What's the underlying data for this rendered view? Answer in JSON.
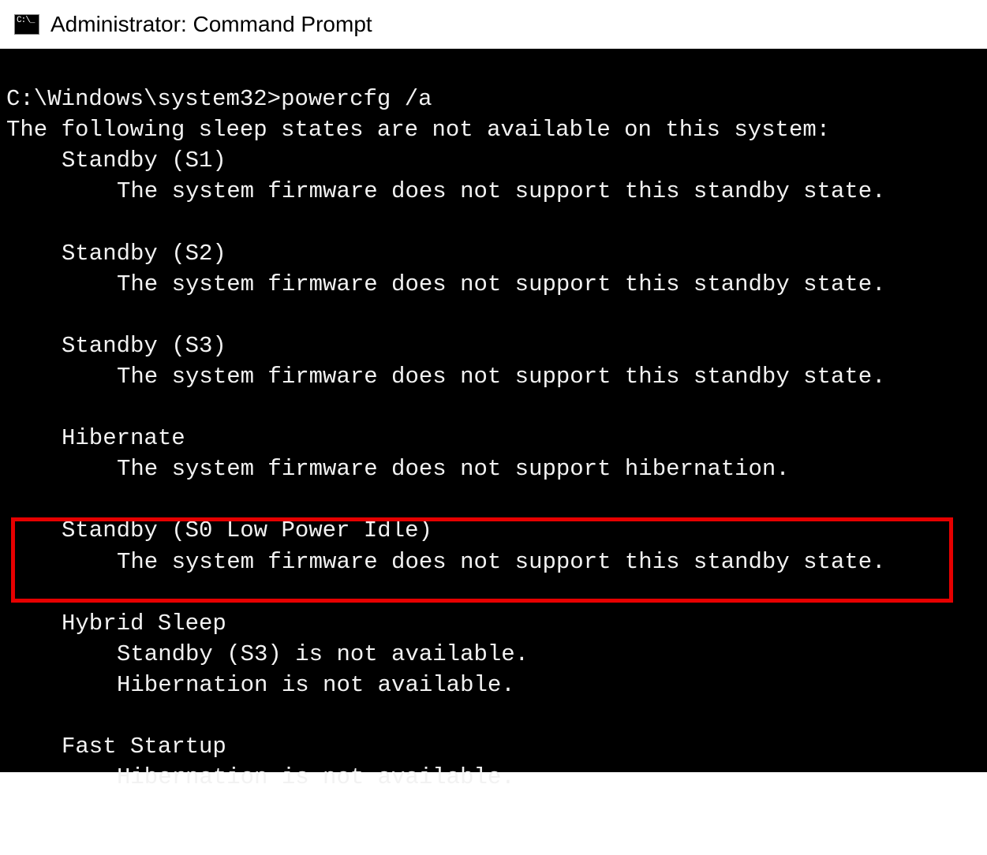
{
  "window": {
    "title": "Administrator: Command Prompt"
  },
  "terminal": {
    "prompt": "C:\\Windows\\system32>",
    "command": "powercfg /a",
    "header": "The following sleep states are not available on this system:",
    "states": [
      {
        "name": "Standby (S1)",
        "reasons": [
          "The system firmware does not support this standby state."
        ]
      },
      {
        "name": "Standby (S2)",
        "reasons": [
          "The system firmware does not support this standby state."
        ]
      },
      {
        "name": "Standby (S3)",
        "reasons": [
          "The system firmware does not support this standby state."
        ]
      },
      {
        "name": "Hibernate",
        "reasons": [
          "The system firmware does not support hibernation."
        ]
      },
      {
        "name": "Standby (S0 Low Power Idle)",
        "reasons": [
          "The system firmware does not support this standby state."
        ]
      },
      {
        "name": "Hybrid Sleep",
        "reasons": [
          "Standby (S3) is not available.",
          "Hibernation is not available."
        ]
      },
      {
        "name": "Fast Startup",
        "reasons": [
          "Hibernation is not available."
        ]
      }
    ],
    "highlight_index": 4
  },
  "colors": {
    "highlight_border": "#e60000",
    "terminal_bg": "#000000",
    "terminal_fg": "#f2f2f2"
  }
}
